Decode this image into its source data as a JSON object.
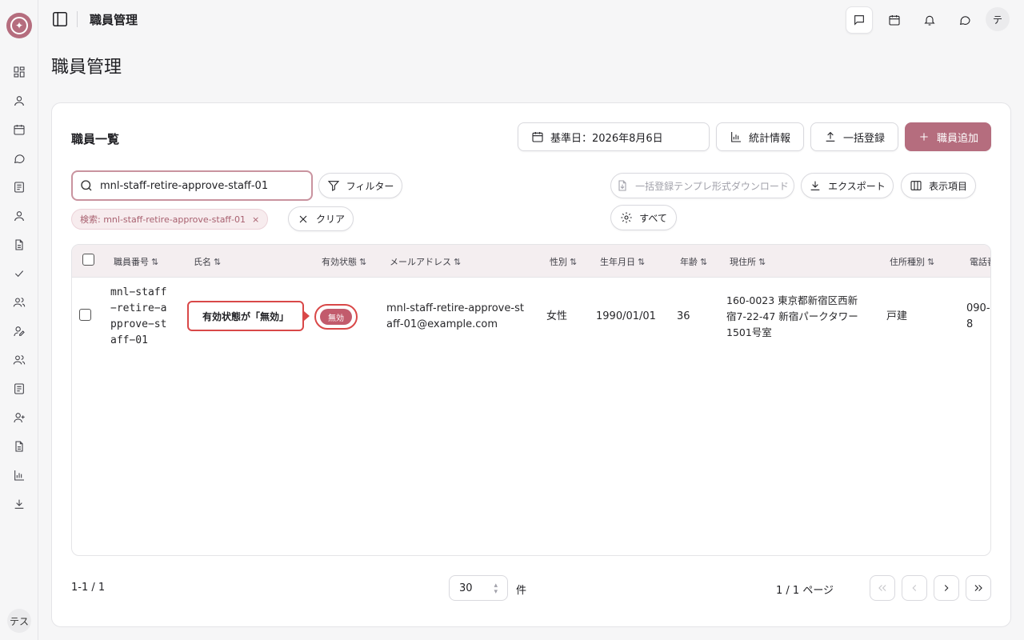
{
  "sidebar": {
    "icons": [
      "dashboard-icon",
      "user-icon",
      "calendar-icon",
      "chat-icon",
      "list-icon",
      "user-icon",
      "document-icon",
      "check-icon",
      "users-icon",
      "user-edit-icon",
      "users-icon",
      "list-icon",
      "user-plus-icon",
      "document-icon",
      "chart-icon",
      "download-icon"
    ],
    "avatar": "テス"
  },
  "header": {
    "title": "職員管理",
    "avatar": "テ"
  },
  "page": {
    "title": "職員管理"
  },
  "card": {
    "title": "職員一覧",
    "date_button": "基準日：2026年8月6日",
    "stats_button": "統計情報",
    "bulk_register_button": "一括登録",
    "add_staff_button": "職員追加"
  },
  "toolbar": {
    "search_value": "mnl-staff-retire-approve-staff-01",
    "filter_button": "フィルター",
    "template_download_button": "一括登録テンプレ形式ダウンロード",
    "export_button": "エクスポート",
    "columns_button": "表示項目",
    "all_button": "すべて",
    "clear_button": "クリア",
    "search_chip": "検索: mnl-staff-retire-approve-staff-01",
    "chip_close": "×"
  },
  "table": {
    "headers": {
      "staff_no": "職員番号",
      "name": "氏名",
      "status": "有効状態",
      "email": "メールアドレス",
      "gender": "性別",
      "birth": "生年月日",
      "age": "年齢",
      "address": "現住所",
      "address_type": "住所種別",
      "phone": "電話番号"
    },
    "sort_glyph": "⇅",
    "row": {
      "staff_no_lines": [
        "mnl−staff",
        "−retire−a",
        "pprove−st",
        "aff−01"
      ],
      "status": "無効",
      "email_lines": [
        "mnl-staff-retire-approve-st",
        "aff-01@example.com"
      ],
      "gender": "女性",
      "birth": "1990/01/01",
      "age": "36",
      "address_lines": [
        "160-0023 東京都新宿区西新",
        "宿7-22-47 新宿パークタワー",
        "1501号室"
      ],
      "address_type": "戸建",
      "phone_lines": [
        "090-",
        "8"
      ]
    },
    "callout": "有効状態が「無効」"
  },
  "footer": {
    "count": "1-1 / 1",
    "per_page": "30",
    "per_unit": "件",
    "page_info": "1 / 1 ページ"
  },
  "colors": {
    "accent": "#b56d7e",
    "highlight": "#d94848"
  }
}
